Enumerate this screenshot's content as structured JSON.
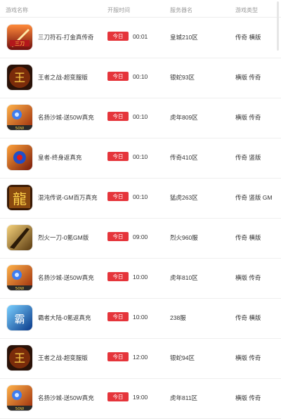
{
  "header": {
    "name": "游戏名称",
    "time": "开服时间",
    "server": "服务器名",
    "type": "游戏类型"
  },
  "rows": [
    {
      "icon": "game-icon-sword-red",
      "name": "三刀符石-打金真传奇",
      "badge": "今日",
      "time": "00:01",
      "server": "皇城210区",
      "type": "传奇 横版"
    },
    {
      "icon": "game-icon-warrior-gold",
      "name": "王者之战-超变服版",
      "badge": "今日",
      "time": "00:10",
      "server": "银蛇93区",
      "type": "横版 传奇"
    },
    {
      "icon": "game-icon-mage-fire",
      "name": "名扬沙城-送50W真充",
      "badge": "今日",
      "time": "00:10",
      "server": "虎年809区",
      "type": "横版 传奇"
    },
    {
      "icon": "game-icon-mage-orb",
      "name": "皇者-终身返真充",
      "badge": "今日",
      "time": "00:10",
      "server": "传奇410区",
      "type": "传奇 竖版"
    },
    {
      "icon": "game-icon-dragon-gold",
      "name": "混沌传说-GM百万真充",
      "badge": "今日",
      "time": "00:10",
      "server": "猛虎263区",
      "type": "传奇 竖版 GM"
    },
    {
      "icon": "game-icon-blade-gold",
      "name": "烈火一刀-0氪GM版",
      "badge": "今日",
      "time": "09:00",
      "server": "烈火960服",
      "type": "传奇 横版"
    },
    {
      "icon": "game-icon-mage-fire",
      "name": "名扬沙城-送50W真充",
      "badge": "今日",
      "time": "10:00",
      "server": "虎年810区",
      "type": "横版 传奇"
    },
    {
      "icon": "game-icon-dragon-blue",
      "name": "霸者大陆-0氪返真充",
      "badge": "今日",
      "time": "10:00",
      "server": "238服",
      "type": "传奇 横版"
    },
    {
      "icon": "game-icon-warrior-gold",
      "name": "王者之战-超变服版",
      "badge": "今日",
      "time": "12:00",
      "server": "银蛇94区",
      "type": "横版 传奇"
    },
    {
      "icon": "game-icon-mage-fire",
      "name": "名扬沙城-送50W真充",
      "badge": "今日",
      "time": "19:00",
      "server": "虎年811区",
      "type": "横版 传奇"
    }
  ],
  "colors": {
    "badge": "#e5353b",
    "text": "#333333",
    "header_text": "#9a9a9a"
  }
}
